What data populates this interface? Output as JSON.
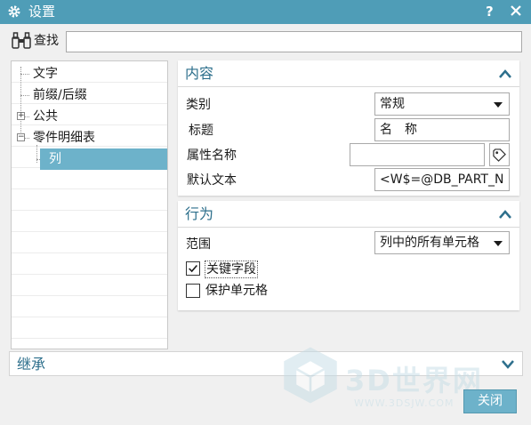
{
  "titlebar": {
    "title": "设置",
    "help": "?",
    "icon": "gear-icon"
  },
  "find": {
    "label": "查找",
    "value": "",
    "placeholder": ""
  },
  "tree": {
    "items": [
      {
        "label": "文字"
      },
      {
        "label": "前缀/后缀"
      },
      {
        "label": "公共",
        "expander": "+"
      },
      {
        "label": "零件明细表",
        "expander": "−"
      },
      {
        "label": "列",
        "selected": true
      }
    ]
  },
  "content_section": {
    "title": "内容",
    "fields": {
      "category": {
        "label": "类别",
        "value": "常规"
      },
      "heading": {
        "label": "标题",
        "value": "名　称"
      },
      "attribute_name": {
        "label": "属性名称",
        "value": ""
      },
      "default_text": {
        "label": "默认文本",
        "value": "<W$=@DB_PART_N"
      }
    }
  },
  "behavior_section": {
    "title": "行为",
    "scope": {
      "label": "范围",
      "value": "列中的所有单元格"
    },
    "key_field": {
      "label": "关键字段",
      "checked": true
    },
    "protect_cell": {
      "label": "保护单元格",
      "checked": false
    }
  },
  "inherit_section": {
    "title": "继承"
  },
  "watermark": {
    "text": "3D世界网",
    "url": "WWW.3DSJW.COM"
  },
  "buttons": {
    "close": "关闭"
  },
  "colors": {
    "titlebar": "#4f9db7",
    "selection": "#6db2ca",
    "section_title": "#2d6f8c"
  }
}
